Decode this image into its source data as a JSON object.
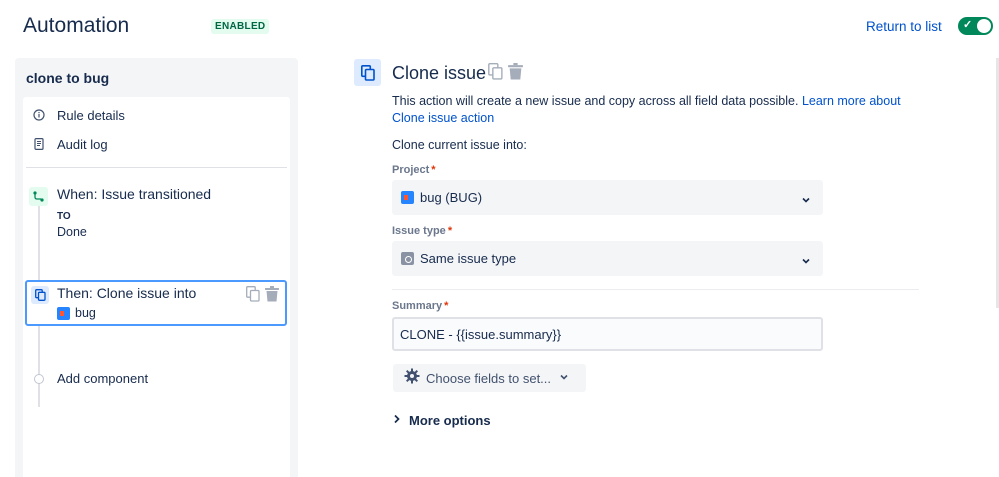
{
  "header": {
    "title": "Automation",
    "status_badge": "ENABLED",
    "return_link": "Return to list",
    "toggle_on": true
  },
  "sidebar": {
    "rule_name": "clone to bug",
    "menu": [
      {
        "label": "Rule details",
        "icon": "info-icon"
      },
      {
        "label": "Audit log",
        "icon": "document-icon"
      }
    ],
    "trigger": {
      "title": "When: Issue transitioned",
      "to_label": "TO",
      "to_value": "Done",
      "icon": "transition-icon"
    },
    "action": {
      "title": "Then: Clone issue into",
      "project": "bug",
      "icon": "clone-icon"
    },
    "add_component": "Add component"
  },
  "main": {
    "title": "Clone issue",
    "description": "This action will create a new issue and copy across all field data possible.",
    "learn_more": "Learn more about Clone issue action",
    "clone_into_label": "Clone current issue into:",
    "project": {
      "label": "Project",
      "required_mark": "*",
      "value": "bug (BUG)"
    },
    "issue_type": {
      "label": "Issue type",
      "required_mark": "*",
      "value": "Same issue type"
    },
    "summary": {
      "label": "Summary",
      "required_mark": "*",
      "value": "CLONE - {{issue.summary}}"
    },
    "choose_fields": "Choose fields to set...",
    "more_options": "More options"
  },
  "colors": {
    "accent": "#0052cc",
    "enabled_green": "#00875a",
    "selected_border": "#4c9aff",
    "required_red": "#de350b"
  }
}
